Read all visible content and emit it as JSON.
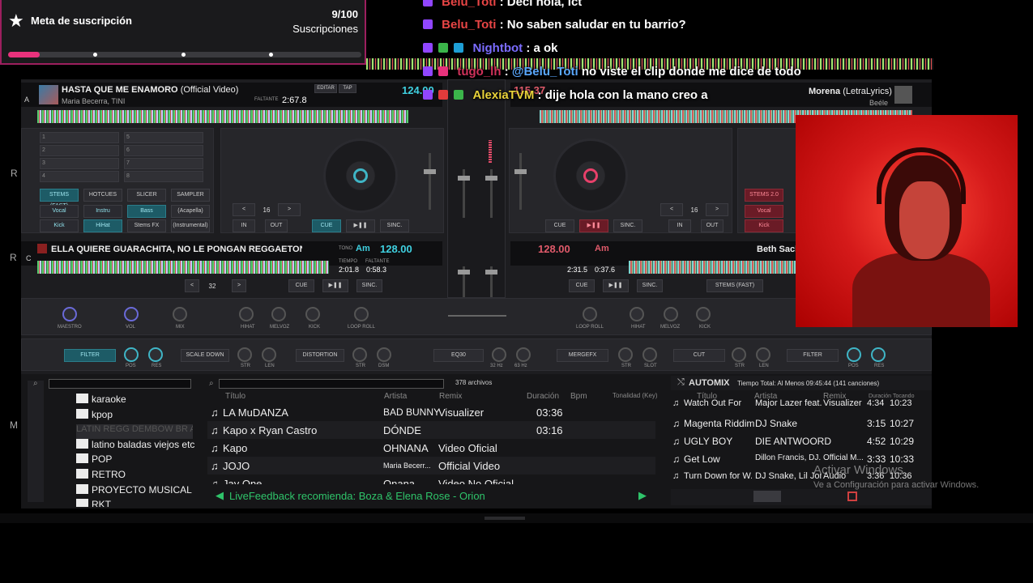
{
  "goal": {
    "title": "Meta de suscripción",
    "count": "9/100",
    "unit": "Suscripciones",
    "progress": 0.09
  },
  "chat": [
    {
      "user": "Belu_Toti",
      "color": "#e84545",
      "msg": "Deci hola, lct"
    },
    {
      "user": "Belu_Toti",
      "color": "#e84545",
      "msg": "No saben saludar en tu barrio?"
    },
    {
      "user": "Nightbot",
      "color": "#7b6cff",
      "msg": "a ok"
    },
    {
      "user": "tugo_lh",
      "color": "#d0315a",
      "msg": "no viste el clip donde me dice de todo",
      "mention": "@Belu_Toti"
    },
    {
      "user": "AlexiaTVM",
      "color": "#e8d23a",
      "msg": "dije hola con la mano creo a"
    }
  ],
  "deckA": {
    "letter": "A",
    "title": "HASTA QUE ME ENAMORO",
    "title_suffix": "(Official Video)",
    "artist": "Maria Becerra, TINI",
    "bpm": "124.00",
    "time_label": "FALTANTE",
    "time": "2:67.8",
    "buttons": [
      "EDITAR",
      "TAP"
    ]
  },
  "deckB": {
    "title": "Morena",
    "title_suffix": "(LetraLyrics)",
    "artist": "Beéle",
    "bpm": "115.37"
  },
  "deckC": {
    "letter": "C",
    "title": "ELLA QUIERE GUARACHITA, NO LE PONGAN REGGAETON - CHI",
    "key": "Am",
    "bpm": "128.00",
    "time1": "2:01.8",
    "time2": "0:58.3",
    "labels": [
      "TONO",
      "TIEMPO",
      "FALTANTE"
    ]
  },
  "deckD": {
    "title": "Beth Sacks",
    "key": "Am",
    "bpm": "128.00",
    "time1": "2:31.5",
    "time2": "0:37.6"
  },
  "pads_left": {
    "tabs": [
      "STEMS (FAST)",
      "HOTCUES",
      "SLICER",
      "SAMPLER"
    ],
    "row1": [
      "Vocal",
      "Instru",
      "Bass",
      "(Acapella)"
    ],
    "row2": [
      "Kick",
      "HiHat",
      "Stems FX",
      "(Instrumental)"
    ]
  },
  "pads_right": {
    "tab": "STEMS 2.0",
    "row1": "Vocal",
    "row2": "Kick"
  },
  "transport": {
    "cue": "CUE",
    "play": "▶❚❚",
    "sync": "SINC.",
    "in": "IN",
    "out": "OUT",
    "loop": "16",
    "loop_c": "32",
    "stems_fast": "STEMS (FAST)"
  },
  "fx_row": {
    "left_labels": [
      "MAESTRO",
      "VOL",
      "MIX"
    ],
    "center_left": [
      "HIHAT",
      "MELVOZ",
      "KICK",
      "LOOP ROLL"
    ],
    "center_right": [
      "LOOP ROLL",
      "HIHAT",
      "MELVOZ",
      "KICK"
    ],
    "filter": "FILTER",
    "pos": "POS",
    "res": "RES",
    "scale": "SCALE DOWN",
    "str": "STR",
    "len": "LEN",
    "distortion": "DISTORTION",
    "dsm": "DSM",
    "eq": "EQ30",
    "hz32": "32 Hz",
    "hz63": "63 Hz",
    "mergefx": "MERGEFX",
    "slot": "SLOT",
    "cut": "CUT",
    "filter2": "FILTER"
  },
  "browser": {
    "count": "378 archivos",
    "folders": [
      "karaoke",
      "kpop",
      "LATIN REGG DEMBOW BR AF",
      "latino baladas viejos etc",
      "POP",
      "RETRO",
      "PROYECTO MUSICAL",
      "RKT"
    ],
    "headers": [
      "Título",
      "Artista",
      "Remix",
      "Duración",
      "Bpm",
      "Tonalidad (Key)"
    ],
    "rows": [
      {
        "title": "LA MuDANZA",
        "artist": "BAD BUNNY",
        "remix": "Visualizer",
        "dur": "03:36"
      },
      {
        "title": "Kapo x Ryan Castro",
        "artist": "DÓNDE",
        "remix": "",
        "dur": "03:16"
      },
      {
        "title": "Kapo",
        "artist": "OHNANA",
        "remix": "Video Oficial",
        "dur": ""
      },
      {
        "title": "JOJO",
        "artist": "Maria Becerr...",
        "remix": "Official Video",
        "dur": ""
      },
      {
        "title": "Jay One",
        "artist": "Onana",
        "remix": "Video No Oficial",
        "dur": ""
      }
    ],
    "feedback": "LiveFeedback recomienda: Boza & Elena Rose - Orion"
  },
  "automix": {
    "title": "AUTOMIX",
    "total": "Tiempo Total: Al Menos 09:45:44 (141 canciones)",
    "headers": [
      "Título",
      "Artista",
      "Remix",
      "Duración",
      "Tocando"
    ],
    "rows": [
      {
        "title": "Watch Out For Th...",
        "artist": "Major Lazer feat...",
        "remix": "Visualizer",
        "dur": "4:34",
        "at": "10:23"
      },
      {
        "title": "Magenta Riddim",
        "artist": "DJ Snake",
        "remix": "",
        "dur": "3:15",
        "at": "10:27"
      },
      {
        "title": "UGLY BOY",
        "artist": "DIE ANTWOORD",
        "remix": "",
        "dur": "4:52",
        "at": "10:29"
      },
      {
        "title": "Get Low",
        "artist": "Dillon Francis, DJ...",
        "remix": "Official M...",
        "dur": "3:33",
        "at": "10:33"
      },
      {
        "title": "Turn Down for W...",
        "artist": "DJ Snake, Lil Jon",
        "remix": "Audio",
        "dur": "3:36",
        "at": "10:36"
      }
    ]
  },
  "windows": {
    "line1": "Activar Windows",
    "line2": "Ve a Configuración para activar Windows."
  },
  "side_letters": [
    "R",
    "R",
    "M"
  ]
}
